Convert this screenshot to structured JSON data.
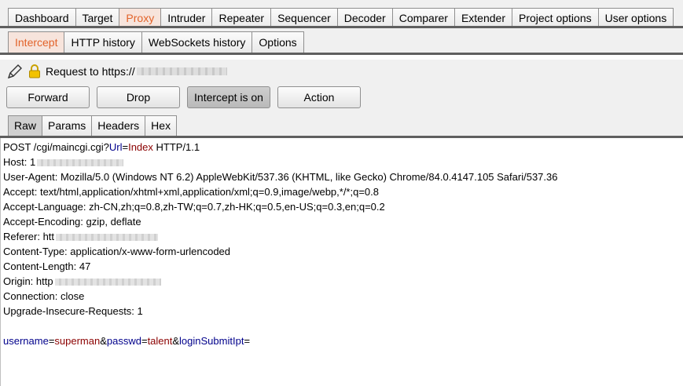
{
  "main_tabs": [
    "Dashboard",
    "Target",
    "Proxy",
    "Intruder",
    "Repeater",
    "Sequencer",
    "Decoder",
    "Comparer",
    "Extender",
    "Project options",
    "User options"
  ],
  "main_active": "Proxy",
  "proxy_tabs": [
    "Intercept",
    "HTTP history",
    "WebSockets history",
    "Options"
  ],
  "proxy_active": "Intercept",
  "request_line": {
    "prefix": "Request to https://"
  },
  "buttons": {
    "forward": "Forward",
    "drop": "Drop",
    "intercept": "Intercept is on",
    "action": "Action"
  },
  "editor_tabs": [
    "Raw",
    "Params",
    "Headers",
    "Hex"
  ],
  "editor_active": "Raw",
  "request": {
    "line1": {
      "method_path": "POST /cgi/maincgi.cgi?",
      "param": "Url",
      "eq": "=",
      "value": "Index",
      "proto": " HTTP/1.1"
    },
    "host": "Host: 1",
    "user_agent": "User-Agent: Mozilla/5.0 (Windows NT 6.2) AppleWebKit/537.36 (KHTML, like Gecko) Chrome/84.0.4147.105 Safari/537.36",
    "accept": "Accept: text/html,application/xhtml+xml,application/xml;q=0.9,image/webp,*/*;q=0.8",
    "accept_language": "Accept-Language: zh-CN,zh;q=0.8,zh-TW;q=0.7,zh-HK;q=0.5,en-US;q=0.3,en;q=0.2",
    "accept_encoding": "Accept-Encoding: gzip, deflate",
    "referer": "Referer: htt",
    "content_type": "Content-Type: application/x-www-form-urlencoded",
    "content_length": "Content-Length: 47",
    "origin": "Origin: http",
    "connection": "Connection: close",
    "upgrade": "Upgrade-Insecure-Requests: 1",
    "body": [
      {
        "k": "username",
        "v": "superman"
      },
      {
        "k": "passwd",
        "v": "talent"
      },
      {
        "k": "loginSubmitIpt",
        "v": ""
      }
    ]
  }
}
